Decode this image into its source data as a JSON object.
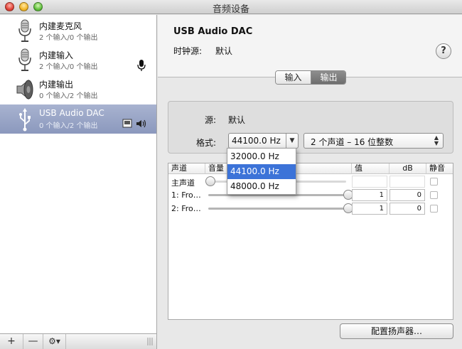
{
  "window": {
    "title": "音频设备"
  },
  "sidebar": {
    "devices": [
      {
        "name": "内建麦克风",
        "io": "2 个输入/0 个输出",
        "icon": "microphone-icon"
      },
      {
        "name": "内建输入",
        "io": "2 个输入/0 个输出",
        "icon": "microphone-icon",
        "badge": "mic-badge-icon"
      },
      {
        "name": "内建输出",
        "io": "0 个输入/2 个输出",
        "icon": "speaker-icon"
      },
      {
        "name": "USB Audio DAC",
        "io": "0 个输入/2 个输出",
        "icon": "usb-icon",
        "selected": true
      }
    ],
    "toolbar": {
      "add": "+",
      "remove": "—",
      "gear": "⚙▾"
    }
  },
  "header": {
    "device_name": "USB Audio DAC",
    "clock_label": "时钟源:",
    "clock_value": "默认",
    "help": "?"
  },
  "tabs": [
    {
      "label": "输入",
      "active": false
    },
    {
      "label": "输出",
      "active": true
    }
  ],
  "format": {
    "source_label": "源:",
    "source_value": "默认",
    "format_label": "格式:",
    "rate_value": "44100.0 Hz",
    "channels_value": "2 个声道 – 16 位整数",
    "rate_options": [
      "32000.0 Hz",
      "44100.0 Hz",
      "48000.0 Hz"
    ],
    "selected_rate_index": 1
  },
  "table": {
    "headers": [
      "声道",
      "音量",
      "值",
      "dB",
      "静音"
    ],
    "rows": [
      {
        "name": "主声道",
        "volume": 0.0,
        "value": "",
        "db": "",
        "muted": false,
        "enabled": false
      },
      {
        "name": "1: Fro…",
        "volume": 1.0,
        "value": "1",
        "db": "0",
        "muted": false,
        "enabled": true
      },
      {
        "name": "2: Fro…",
        "volume": 1.0,
        "value": "1",
        "db": "0",
        "muted": false,
        "enabled": true
      }
    ]
  },
  "configure_button": "配置扬声器…",
  "colors": {
    "selection": "#3c73d8",
    "sidebar_selected": "#9aa5c6"
  }
}
